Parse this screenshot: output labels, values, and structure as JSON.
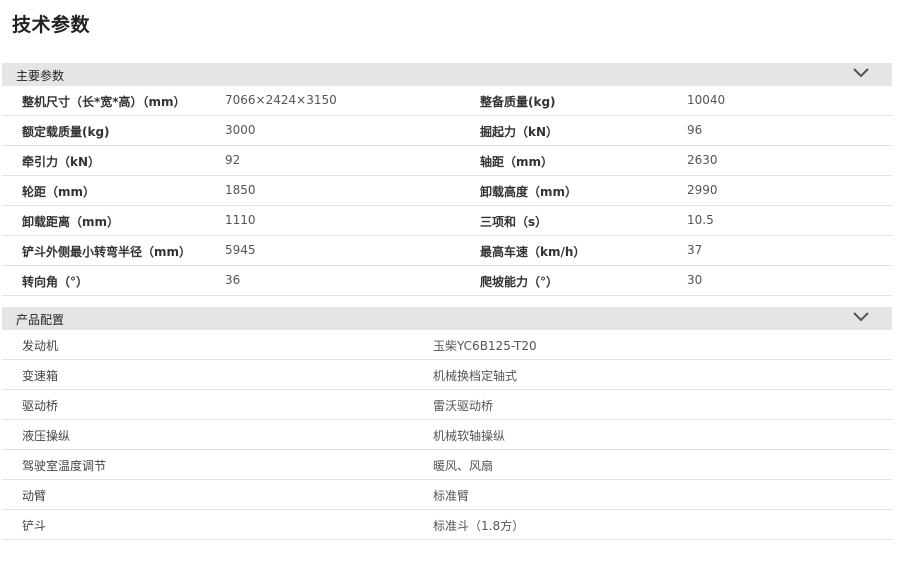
{
  "page_title": "技术参数",
  "colors": {
    "header_bg": "#e5e5e5",
    "row_border": "#e3e3e3",
    "text": "#333333"
  },
  "main_params": {
    "header": "主要参数",
    "header_icon": "chevron-down-icon",
    "rows": [
      {
        "label1": "整机尺寸（长*宽*高）（mm）",
        "value1": "7066×2424×3150",
        "label2": "整备质量(kg)",
        "value2": "10040"
      },
      {
        "label1": "额定载质量(kg)",
        "value1": "3000",
        "label2": "掘起力（kN）",
        "value2": "96"
      },
      {
        "label1": "牵引力（kN）",
        "value1": "92",
        "label2": "轴距（mm）",
        "value2": "2630"
      },
      {
        "label1": "轮距（mm）",
        "value1": "1850",
        "label2": "卸载高度（mm）",
        "value2": "2990"
      },
      {
        "label1": "卸载距离（mm）",
        "value1": "1110",
        "label2": "三项和（s）",
        "value2": "10.5"
      },
      {
        "label1": "铲斗外侧最小转弯半径（mm）",
        "value1": "5945",
        "label2": "最高车速（km/h）",
        "value2": "37"
      },
      {
        "label1": "转向角（°）",
        "value1": "36",
        "label2": "爬坡能力（°）",
        "value2": "30"
      }
    ]
  },
  "product_config": {
    "header": "产品配置",
    "header_icon": "chevron-down-icon",
    "rows": [
      {
        "label": "发动机",
        "value": "玉柴YC6B125-T20"
      },
      {
        "label": "变速箱",
        "value": "机械换档定轴式"
      },
      {
        "label": "驱动桥",
        "value": "雷沃驱动桥"
      },
      {
        "label": "液压操纵",
        "value": "机械软轴操纵"
      },
      {
        "label": "驾驶室温度调节",
        "value": "暖风、风扇"
      },
      {
        "label": "动臂",
        "value": "标准臂"
      },
      {
        "label": "铲斗",
        "value": "标准斗（1.8方）"
      }
    ]
  }
}
